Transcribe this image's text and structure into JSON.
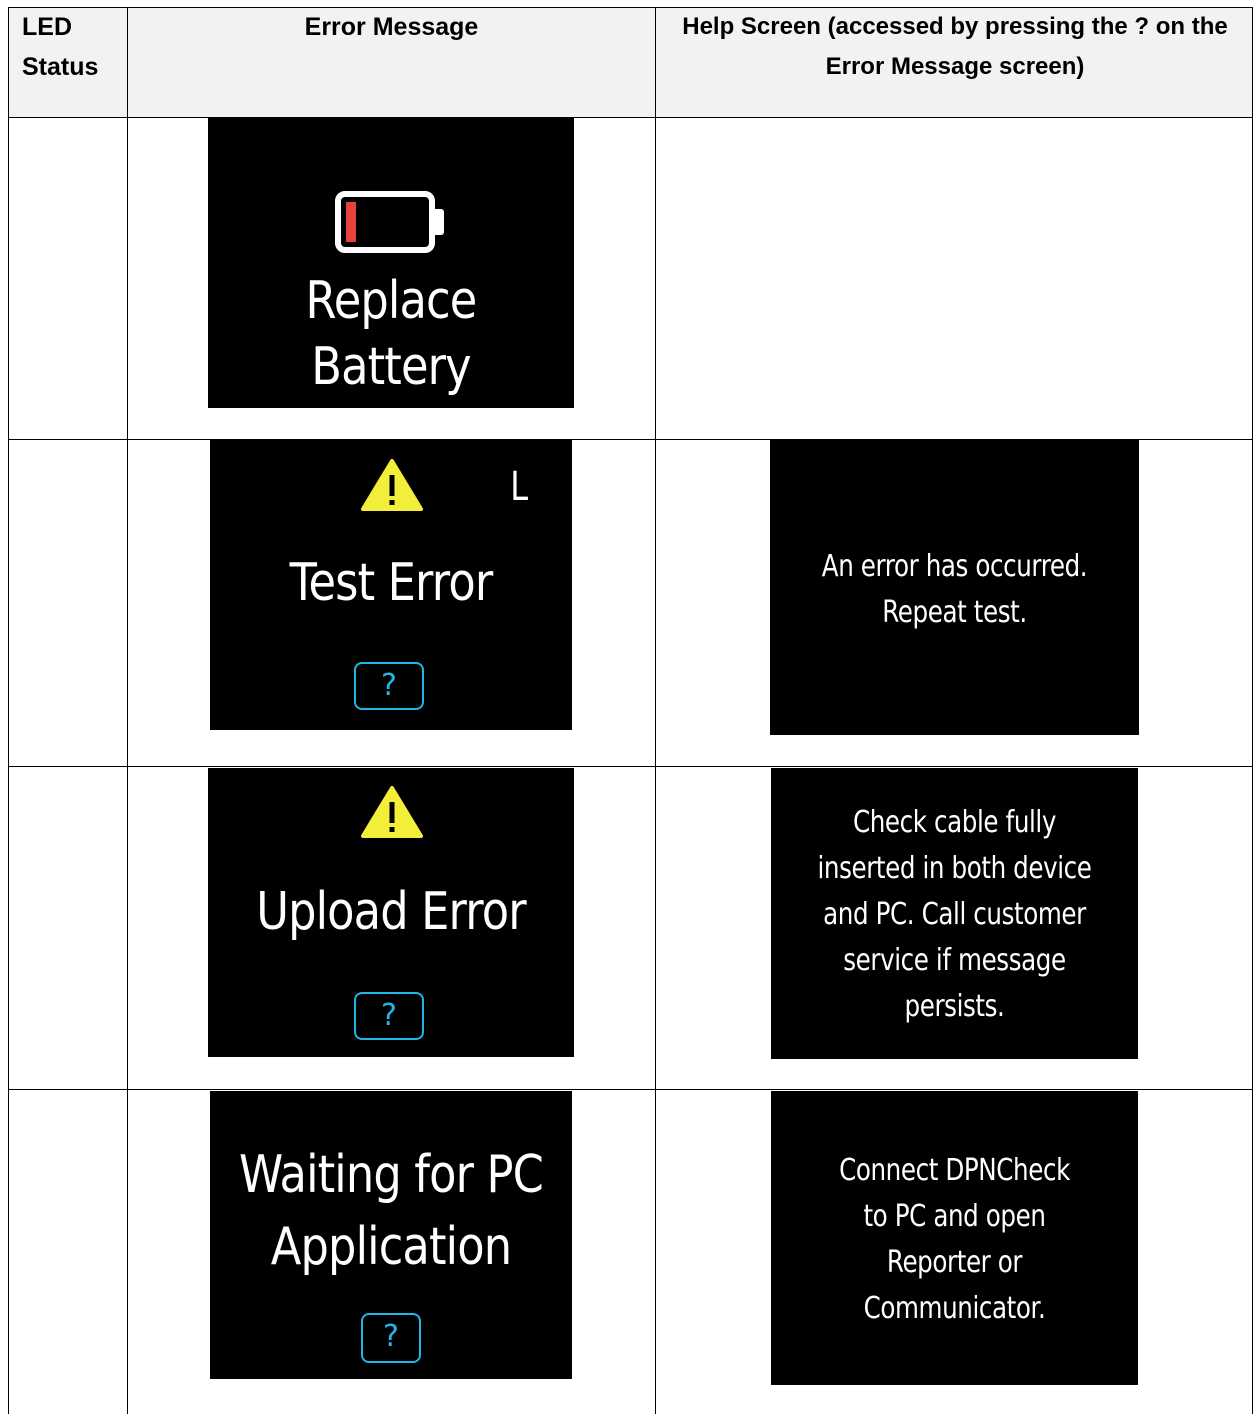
{
  "table": {
    "headers": {
      "led_status": "LED Status",
      "error_message": "Error Message",
      "help_screen": "Help Screen (accessed by pressing the ? on the Error Message screen)"
    },
    "rows": [
      {
        "led_status": "",
        "error_screen": {
          "title": "Replace Battery",
          "icon": "battery-low-icon"
        },
        "help_screen": null
      },
      {
        "led_status": "",
        "error_screen": {
          "title": "Test Error",
          "icon": "warning-icon",
          "side_letter": "L",
          "help_button": "?"
        },
        "help_screen": {
          "lines": [
            "An error has occurred.",
            "Repeat test."
          ]
        }
      },
      {
        "led_status": "",
        "error_screen": {
          "title": "Upload Error",
          "icon": "warning-icon",
          "help_button": "?"
        },
        "help_screen": {
          "lines": [
            "Check cable fully",
            "inserted in both device",
            "and PC. Call customer",
            "service if message",
            "persists."
          ]
        }
      },
      {
        "led_status": "",
        "error_screen": {
          "title_lines": [
            "Waiting for PC",
            "Application"
          ],
          "help_button": "?"
        },
        "help_screen": {
          "lines": [
            "Connect DPNCheck",
            "to PC and open",
            "Reporter or",
            "Communicator."
          ]
        }
      }
    ]
  },
  "colors": {
    "screen_background": "#000000",
    "help_button": "#1fb6e8",
    "warning_fill": "#f2ee3a",
    "battery_level": "#e8423f",
    "header_background": "#f2f2f2"
  }
}
